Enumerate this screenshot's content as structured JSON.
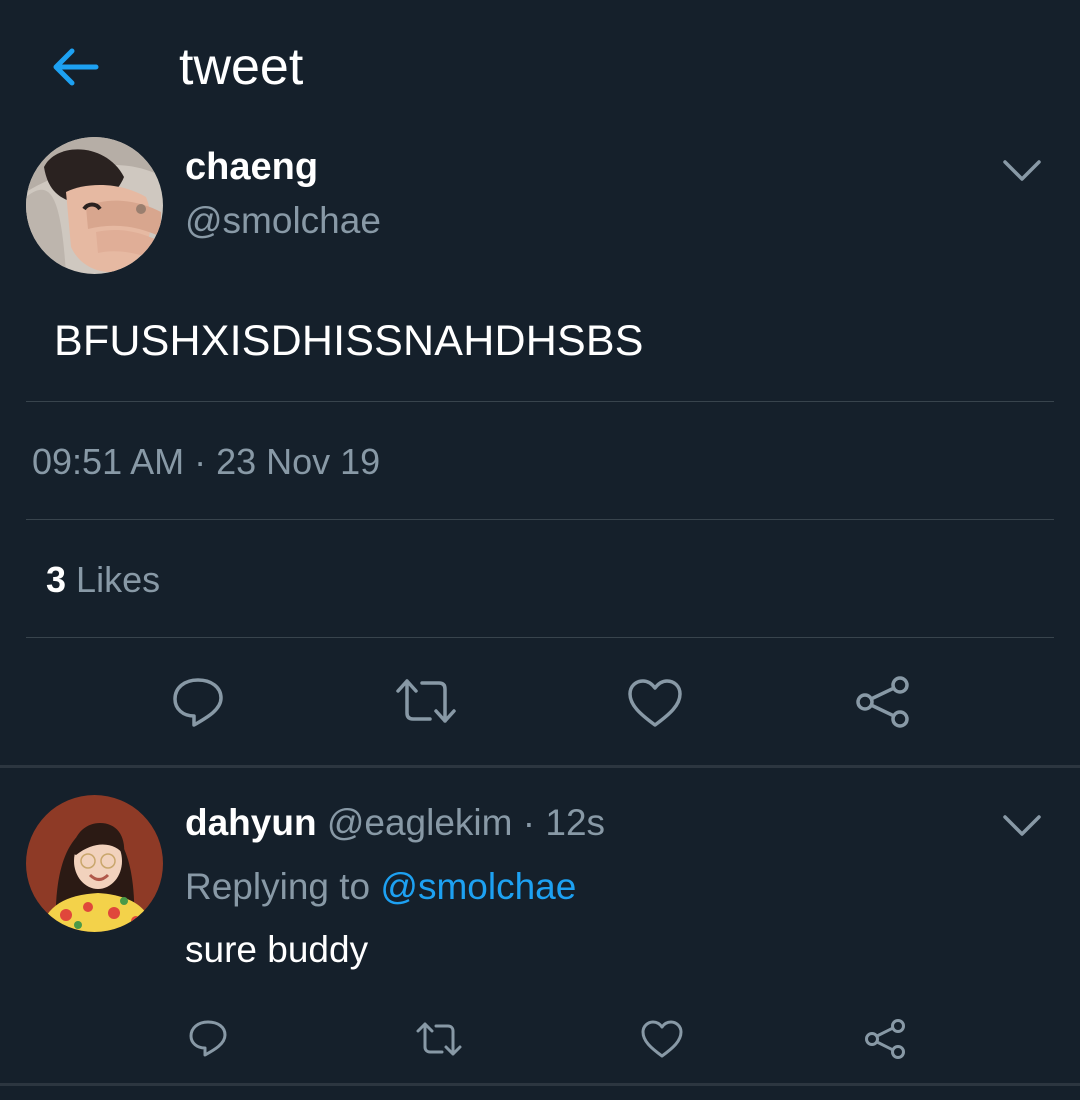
{
  "header": {
    "title": "tweet",
    "back_icon": "arrow-left-icon",
    "accent": "#1da1f2"
  },
  "tweet": {
    "display_name": "chaeng",
    "handle": "@smolchae",
    "text": "BFUSHXISDHISSNAHDHSBS",
    "timestamp": "09:51 AM · 23 Nov 19",
    "likes_count": "3",
    "likes_label": "Likes",
    "actions": [
      "reply-icon",
      "retweet-icon",
      "like-icon",
      "share-icon"
    ]
  },
  "reply": {
    "display_name": "dahyun",
    "handle": "@eaglekim",
    "separator": "·",
    "time": "12s",
    "replying_prefix": "Replying to",
    "replying_to": "@smolchae",
    "text": "sure buddy",
    "actions": [
      "reply-icon",
      "retweet-icon",
      "like-icon",
      "share-icon"
    ]
  },
  "colors": {
    "background": "#15202b",
    "secondary_text": "#8899a6",
    "divider": "#38444d",
    "link": "#1da1f2"
  }
}
